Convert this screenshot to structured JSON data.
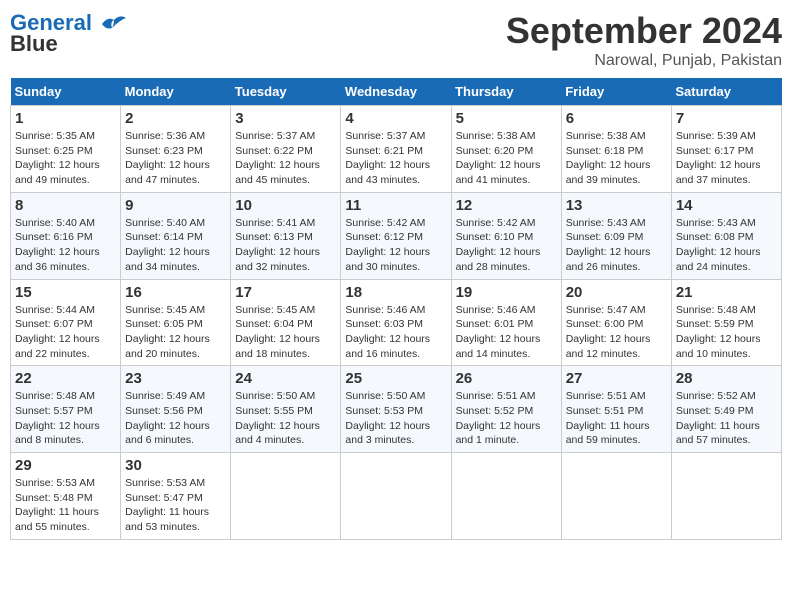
{
  "header": {
    "logo_line1": "General",
    "logo_line2": "Blue",
    "month": "September 2024",
    "location": "Narowal, Punjab, Pakistan"
  },
  "weekdays": [
    "Sunday",
    "Monday",
    "Tuesday",
    "Wednesday",
    "Thursday",
    "Friday",
    "Saturday"
  ],
  "weeks": [
    [
      {
        "day": 1,
        "info": "Sunrise: 5:35 AM\nSunset: 6:25 PM\nDaylight: 12 hours and 49 minutes."
      },
      {
        "day": 2,
        "info": "Sunrise: 5:36 AM\nSunset: 6:23 PM\nDaylight: 12 hours and 47 minutes."
      },
      {
        "day": 3,
        "info": "Sunrise: 5:37 AM\nSunset: 6:22 PM\nDaylight: 12 hours and 45 minutes."
      },
      {
        "day": 4,
        "info": "Sunrise: 5:37 AM\nSunset: 6:21 PM\nDaylight: 12 hours and 43 minutes."
      },
      {
        "day": 5,
        "info": "Sunrise: 5:38 AM\nSunset: 6:20 PM\nDaylight: 12 hours and 41 minutes."
      },
      {
        "day": 6,
        "info": "Sunrise: 5:38 AM\nSunset: 6:18 PM\nDaylight: 12 hours and 39 minutes."
      },
      {
        "day": 7,
        "info": "Sunrise: 5:39 AM\nSunset: 6:17 PM\nDaylight: 12 hours and 37 minutes."
      }
    ],
    [
      {
        "day": 8,
        "info": "Sunrise: 5:40 AM\nSunset: 6:16 PM\nDaylight: 12 hours and 36 minutes."
      },
      {
        "day": 9,
        "info": "Sunrise: 5:40 AM\nSunset: 6:14 PM\nDaylight: 12 hours and 34 minutes."
      },
      {
        "day": 10,
        "info": "Sunrise: 5:41 AM\nSunset: 6:13 PM\nDaylight: 12 hours and 32 minutes."
      },
      {
        "day": 11,
        "info": "Sunrise: 5:42 AM\nSunset: 6:12 PM\nDaylight: 12 hours and 30 minutes."
      },
      {
        "day": 12,
        "info": "Sunrise: 5:42 AM\nSunset: 6:10 PM\nDaylight: 12 hours and 28 minutes."
      },
      {
        "day": 13,
        "info": "Sunrise: 5:43 AM\nSunset: 6:09 PM\nDaylight: 12 hours and 26 minutes."
      },
      {
        "day": 14,
        "info": "Sunrise: 5:43 AM\nSunset: 6:08 PM\nDaylight: 12 hours and 24 minutes."
      }
    ],
    [
      {
        "day": 15,
        "info": "Sunrise: 5:44 AM\nSunset: 6:07 PM\nDaylight: 12 hours and 22 minutes."
      },
      {
        "day": 16,
        "info": "Sunrise: 5:45 AM\nSunset: 6:05 PM\nDaylight: 12 hours and 20 minutes."
      },
      {
        "day": 17,
        "info": "Sunrise: 5:45 AM\nSunset: 6:04 PM\nDaylight: 12 hours and 18 minutes."
      },
      {
        "day": 18,
        "info": "Sunrise: 5:46 AM\nSunset: 6:03 PM\nDaylight: 12 hours and 16 minutes."
      },
      {
        "day": 19,
        "info": "Sunrise: 5:46 AM\nSunset: 6:01 PM\nDaylight: 12 hours and 14 minutes."
      },
      {
        "day": 20,
        "info": "Sunrise: 5:47 AM\nSunset: 6:00 PM\nDaylight: 12 hours and 12 minutes."
      },
      {
        "day": 21,
        "info": "Sunrise: 5:48 AM\nSunset: 5:59 PM\nDaylight: 12 hours and 10 minutes."
      }
    ],
    [
      {
        "day": 22,
        "info": "Sunrise: 5:48 AM\nSunset: 5:57 PM\nDaylight: 12 hours and 8 minutes."
      },
      {
        "day": 23,
        "info": "Sunrise: 5:49 AM\nSunset: 5:56 PM\nDaylight: 12 hours and 6 minutes."
      },
      {
        "day": 24,
        "info": "Sunrise: 5:50 AM\nSunset: 5:55 PM\nDaylight: 12 hours and 4 minutes."
      },
      {
        "day": 25,
        "info": "Sunrise: 5:50 AM\nSunset: 5:53 PM\nDaylight: 12 hours and 3 minutes."
      },
      {
        "day": 26,
        "info": "Sunrise: 5:51 AM\nSunset: 5:52 PM\nDaylight: 12 hours and 1 minute."
      },
      {
        "day": 27,
        "info": "Sunrise: 5:51 AM\nSunset: 5:51 PM\nDaylight: 11 hours and 59 minutes."
      },
      {
        "day": 28,
        "info": "Sunrise: 5:52 AM\nSunset: 5:49 PM\nDaylight: 11 hours and 57 minutes."
      }
    ],
    [
      {
        "day": 29,
        "info": "Sunrise: 5:53 AM\nSunset: 5:48 PM\nDaylight: 11 hours and 55 minutes."
      },
      {
        "day": 30,
        "info": "Sunrise: 5:53 AM\nSunset: 5:47 PM\nDaylight: 11 hours and 53 minutes."
      },
      null,
      null,
      null,
      null,
      null
    ]
  ]
}
